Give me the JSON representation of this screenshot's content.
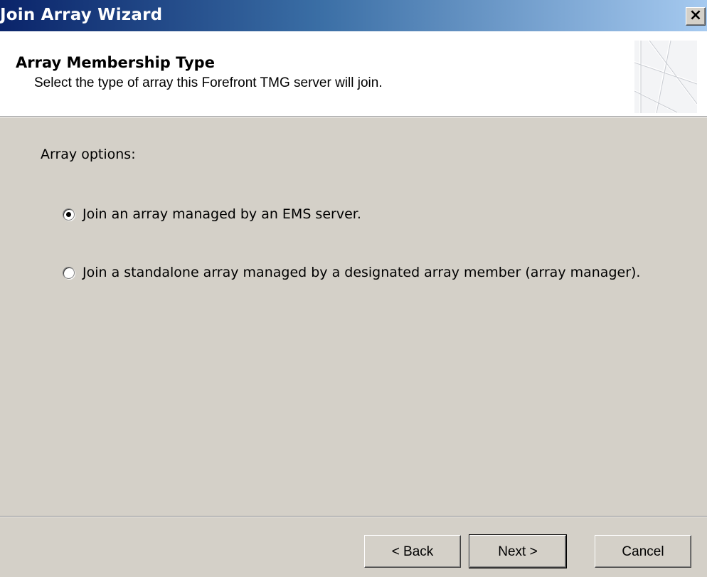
{
  "window": {
    "title": "Join Array Wizard",
    "close_label": "×"
  },
  "header": {
    "title": "Array Membership Type",
    "subtitle": "Select the type of array this Forefront TMG server will join."
  },
  "main": {
    "options_label": "Array options:",
    "options": [
      {
        "label": "Join an array managed by an EMS server.",
        "selected": true
      },
      {
        "label": "Join a standalone array managed by a designated array member (array manager).",
        "selected": false
      }
    ]
  },
  "footer": {
    "back_label": "< Back",
    "next_label": "Next >",
    "cancel_label": "Cancel"
  }
}
